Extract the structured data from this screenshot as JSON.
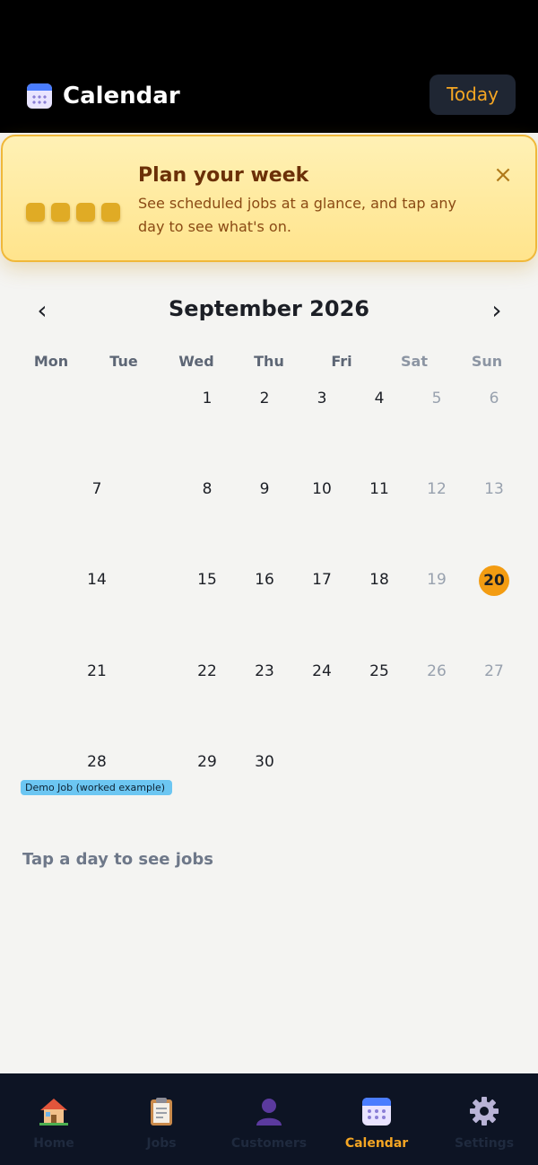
{
  "header": {
    "title": "Calendar",
    "today_label": "Today",
    "icon": "calendar-icon"
  },
  "banner": {
    "title": "Plan your week",
    "text": "See scheduled jobs at a glance, and tap any day to see what's on.",
    "close_symbol": "×",
    "colors": {
      "background": "#ffe48c",
      "border": "#f0b83a",
      "title": "#6b3008"
    }
  },
  "calendar": {
    "month_title": "September 2026",
    "prev_symbol": "‹",
    "next_symbol": "›",
    "weekdays": [
      "Mon",
      "Tue",
      "Wed",
      "Thu",
      "Fri",
      "Sat",
      "Sun"
    ],
    "weeks": [
      [
        "",
        "",
        "1",
        "2",
        "3",
        "4",
        "5",
        "6"
      ],
      [
        "7",
        "",
        "8",
        "9",
        "10",
        "11",
        "12",
        "13"
      ],
      [
        "14",
        "",
        "15",
        "16",
        "17",
        "18",
        "19",
        "20"
      ],
      [
        "21",
        "",
        "22",
        "23",
        "24",
        "25",
        "26",
        "27"
      ],
      [
        "28",
        "",
        "29",
        "30",
        "",
        "",
        "",
        ""
      ]
    ],
    "today": "20",
    "events": [
      {
        "day": "28",
        "label": "Demo Job (worked example)",
        "color": "#6cc6f2"
      }
    ]
  },
  "hint": "Tap a day to see jobs",
  "tabs": [
    {
      "label": "Home",
      "icon": "house-icon",
      "active": false
    },
    {
      "label": "Jobs",
      "icon": "clipboard-icon",
      "active": false
    },
    {
      "label": "Customers",
      "icon": "person-icon",
      "active": false
    },
    {
      "label": "Calendar",
      "icon": "calendar-icon",
      "active": true
    },
    {
      "label": "Settings",
      "icon": "gear-icon",
      "active": false
    }
  ],
  "colors": {
    "accent": "#f39c12",
    "today_button_text": "#f5a623",
    "header_bg": "#000000",
    "tabbar_bg": "#0d1424"
  }
}
